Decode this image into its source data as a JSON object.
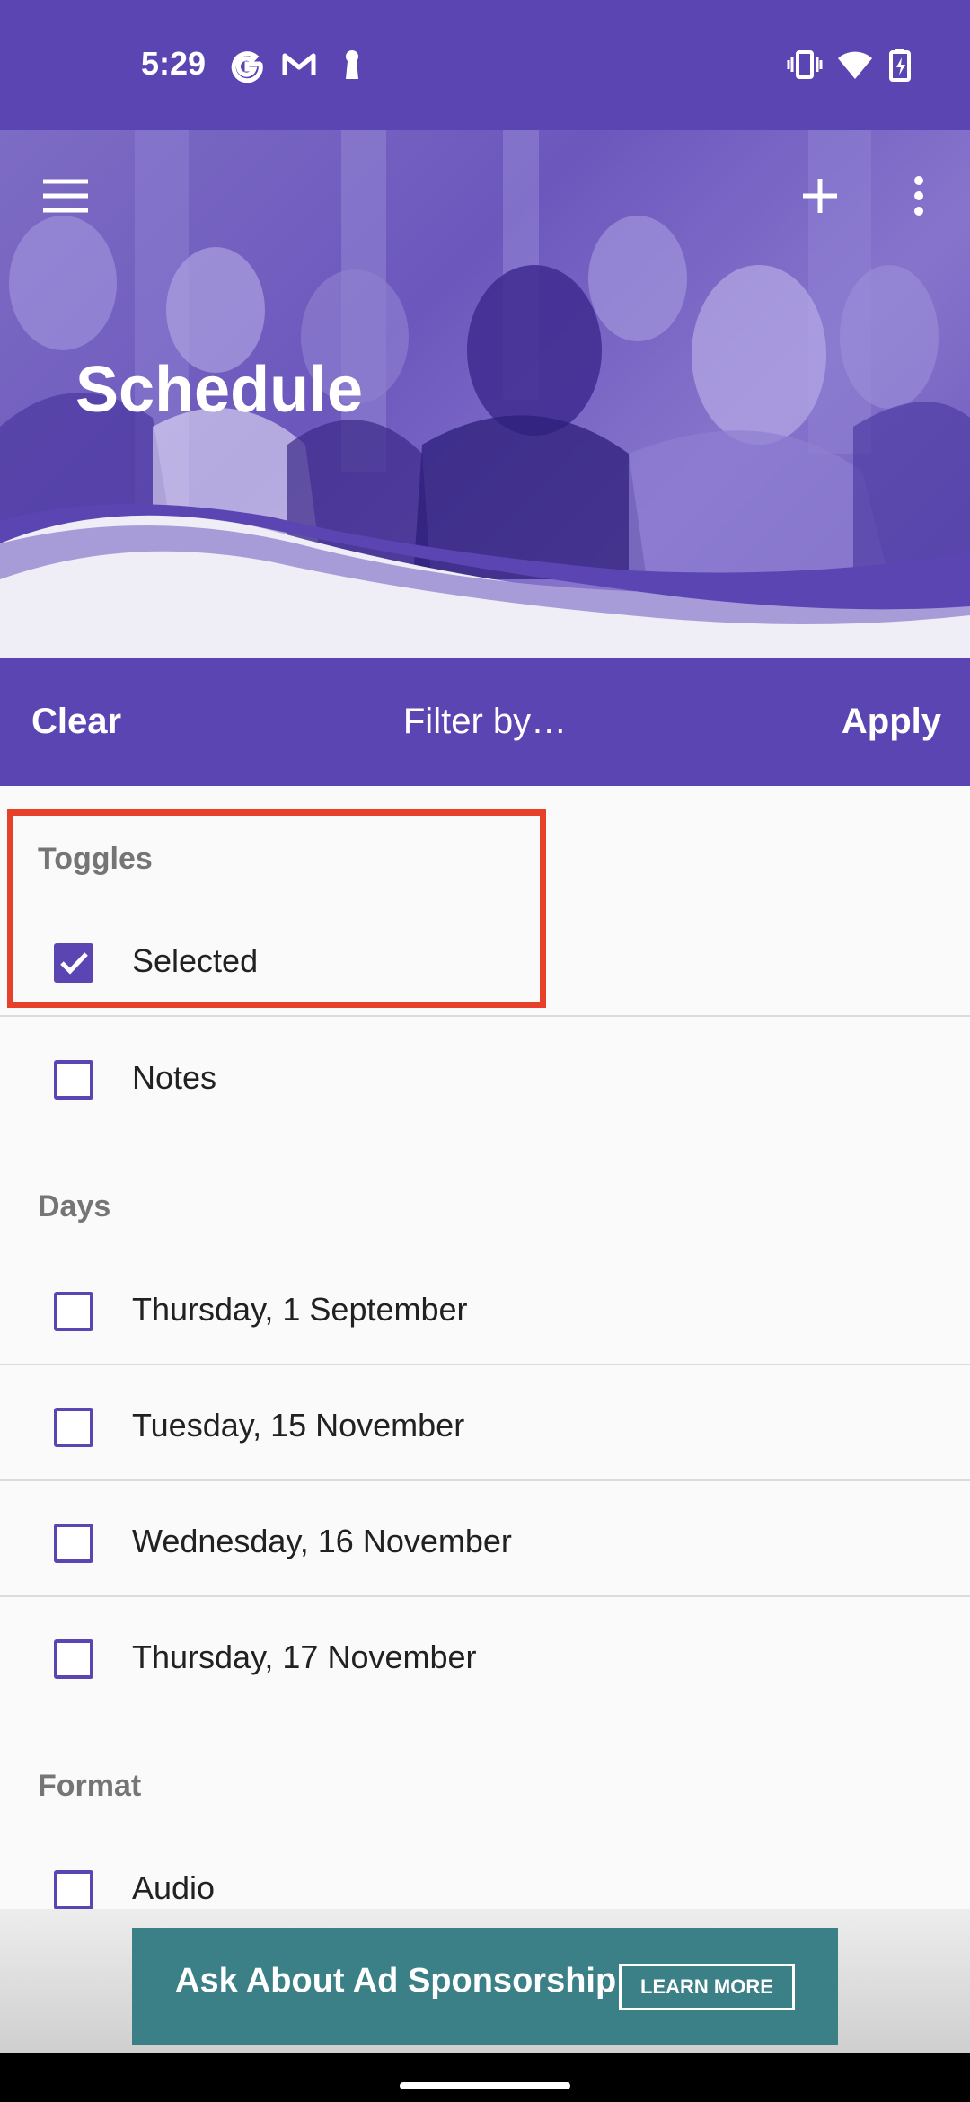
{
  "status_bar": {
    "time": "5:29"
  },
  "header": {
    "title": "Schedule"
  },
  "filter_bar": {
    "clear": "Clear",
    "title": "Filter by…",
    "apply": "Apply"
  },
  "sections": {
    "toggles": "Toggles",
    "days": "Days",
    "format": "Format"
  },
  "items": {
    "selected": {
      "label": "Selected",
      "checked": true
    },
    "notes": {
      "label": "Notes",
      "checked": false
    },
    "day1": {
      "label": "Thursday, 1 September",
      "checked": false
    },
    "day2": {
      "label": "Tuesday, 15 November",
      "checked": false
    },
    "day3": {
      "label": "Wednesday, 16 November",
      "checked": false
    },
    "day4": {
      "label": "Thursday, 17 November",
      "checked": false
    },
    "audio": {
      "label": "Audio",
      "checked": false
    }
  },
  "ad": {
    "text": "Ask About Ad Sponsorship",
    "button": "LEARN MORE"
  },
  "colors": {
    "primary": "#5b45b3",
    "highlight": "#e8412b",
    "ad": "#3a8086"
  }
}
